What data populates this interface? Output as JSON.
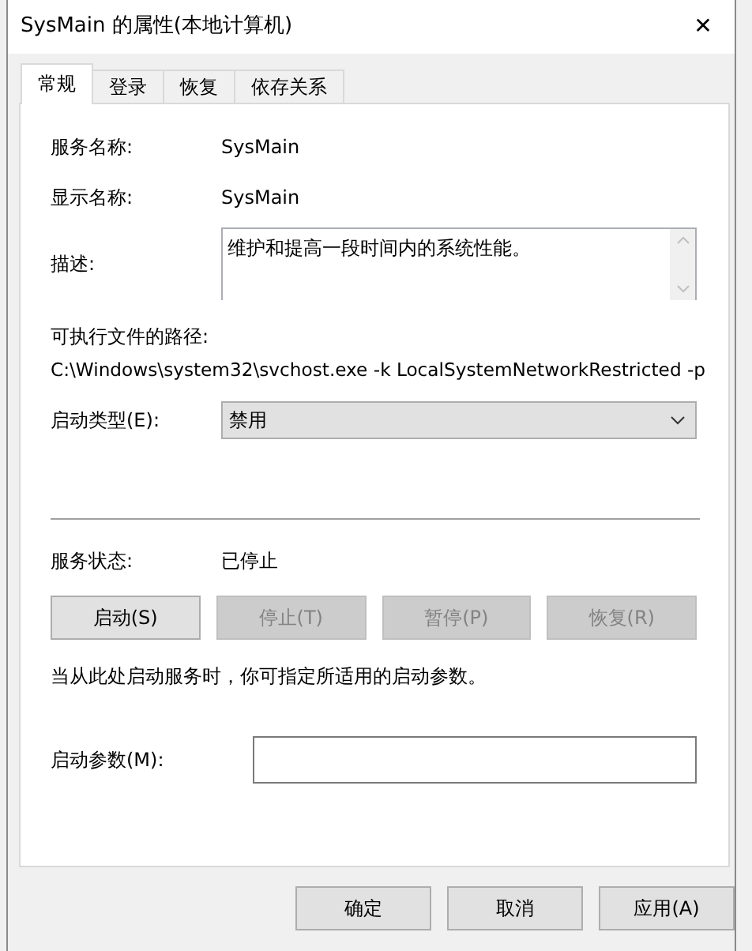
{
  "window": {
    "title": "SysMain 的属性(本地计算机)",
    "close": "✕"
  },
  "tabs": [
    {
      "label": "常规",
      "selected": true
    },
    {
      "label": "登录",
      "selected": false
    },
    {
      "label": "恢复",
      "selected": false
    },
    {
      "label": "依存关系",
      "selected": false
    }
  ],
  "service_name": {
    "label": "服务名称:",
    "value": "SysMain"
  },
  "display_name": {
    "label": "显示名称:",
    "value": "SysMain"
  },
  "description": {
    "label": "描述:",
    "value": "维护和提高一段时间内的系统性能。"
  },
  "executable_path": {
    "label": "可执行文件的路径:",
    "value": "C:\\Windows\\system32\\svchost.exe -k LocalSystemNetworkRestricted -p"
  },
  "startup_type": {
    "label": "启动类型(E):",
    "value": "禁用"
  },
  "service_status": {
    "label": "服务状态:",
    "value": "已停止"
  },
  "service_buttons": [
    {
      "label": "启动(S)",
      "disabled": false
    },
    {
      "label": "停止(T)",
      "disabled": true
    },
    {
      "label": "暂停(P)",
      "disabled": true
    },
    {
      "label": "恢复(R)",
      "disabled": true
    }
  ],
  "hint": "当从此处启动服务时，你可指定所适用的启动参数。",
  "start_parameters": {
    "label": "启动参数(M):"
  },
  "dialog_buttons": [
    {
      "label": "确定",
      "disabled": false
    },
    {
      "label": "取消",
      "disabled": false
    },
    {
      "label": "应用(A)",
      "disabled": false
    }
  ]
}
